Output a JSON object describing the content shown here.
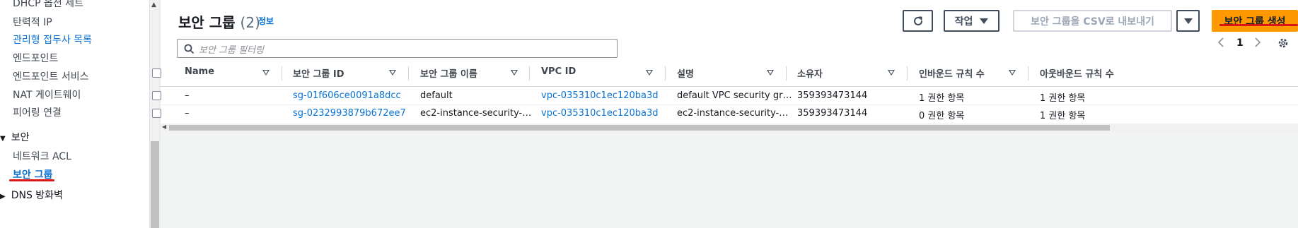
{
  "sidebar": {
    "items": [
      {
        "label": "DHCP 옵션 세트"
      },
      {
        "label": "탄력적 IP"
      },
      {
        "label": "관리형 접두사 목록"
      },
      {
        "label": "엔드포인트"
      },
      {
        "label": "엔드포인트 서비스"
      },
      {
        "label": "NAT 게이트웨이"
      },
      {
        "label": "피어링 연결"
      }
    ],
    "section": "보안",
    "sub_items": [
      {
        "label": "네트워크 ACL"
      },
      {
        "label": "보안 그룹"
      }
    ],
    "next_section": "DNS 방화벽"
  },
  "header": {
    "title": "보안 그룹",
    "count": "(2)",
    "info": "정보"
  },
  "toolbar": {
    "actions_label": "작업",
    "export_label": "보안 그룹을 CSV로 내보내기",
    "create_label": "보안 그룹 생성"
  },
  "search": {
    "placeholder": "보안 그룹 필터링"
  },
  "pagination": {
    "page": "1"
  },
  "table": {
    "columns": [
      "Name",
      "보안 그룹 ID",
      "보안 그룹 이름",
      "VPC ID",
      "설명",
      "소유자",
      "인바운드 규칙 수",
      "아웃바운드 규칙 수"
    ],
    "rows": [
      {
        "name": "–",
        "sg_id": "sg-01f606ce0091a8dcc",
        "sg_name": "default",
        "vpc_id": "vpc-035310c1ec120ba3d",
        "description": "default VPC security gr…",
        "owner": "359393473144",
        "inbound": "1 권한 항목",
        "outbound": "1 권한 항목"
      },
      {
        "name": "–",
        "sg_id": "sg-0232993879b672ee7",
        "sg_name": "ec2-instance-security-…",
        "vpc_id": "vpc-035310c1ec120ba3d",
        "description": "ec2-instance-security-…",
        "owner": "359393473144",
        "inbound": "0 권한 항목",
        "outbound": "1 권한 항목"
      }
    ]
  },
  "colors": {
    "link": "#0972d3",
    "primary": "#ff9900",
    "annotation_underline": "#d91515"
  }
}
